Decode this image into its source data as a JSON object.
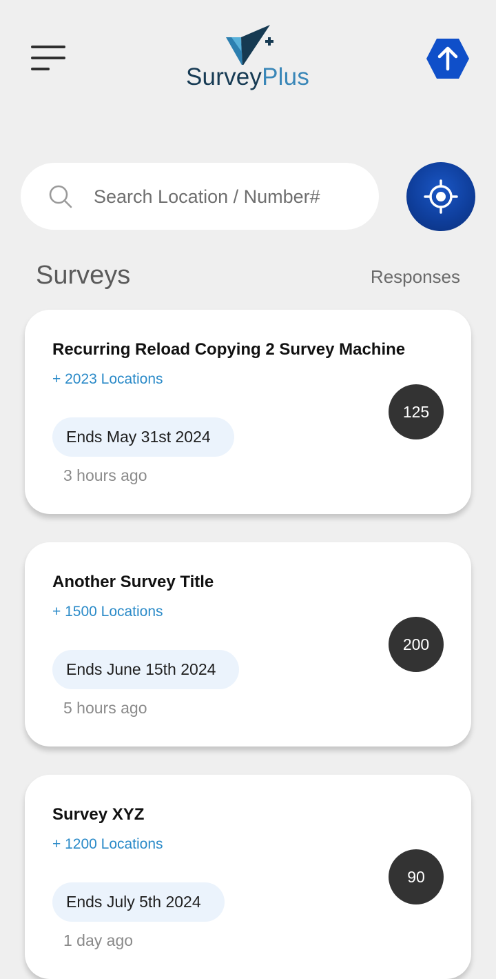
{
  "header": {
    "brand_part1": "Survey",
    "brand_part2": "Plus",
    "menu_icon": "hamburger-menu-icon",
    "upload_icon": "upload-arrow-icon",
    "colors": {
      "brand_dark": "#173b54",
      "brand_light": "#3a87b8",
      "accent_blue": "#0f4fc9"
    }
  },
  "search": {
    "placeholder": "Search Location / Number#",
    "value": "",
    "icon": "search-icon",
    "locate_icon": "crosshair-location-icon"
  },
  "section": {
    "title": "Surveys",
    "responses_label": "Responses"
  },
  "surveys": [
    {
      "title": "Recurring Reload Copying 2 Survey Machine",
      "locations": "+ 2023 Locations",
      "ends": "Ends May 31st 2024",
      "time": "3 hours ago",
      "responses": "125"
    },
    {
      "title": "Another Survey Title",
      "locations": "+ 1500 Locations",
      "ends": "Ends June 15th 2024",
      "time": "5 hours ago",
      "responses": "200"
    },
    {
      "title": "Survey XYZ",
      "locations": "+ 1200 Locations",
      "ends": "Ends July 5th 2024",
      "time": "1 day ago",
      "responses": "90"
    }
  ]
}
